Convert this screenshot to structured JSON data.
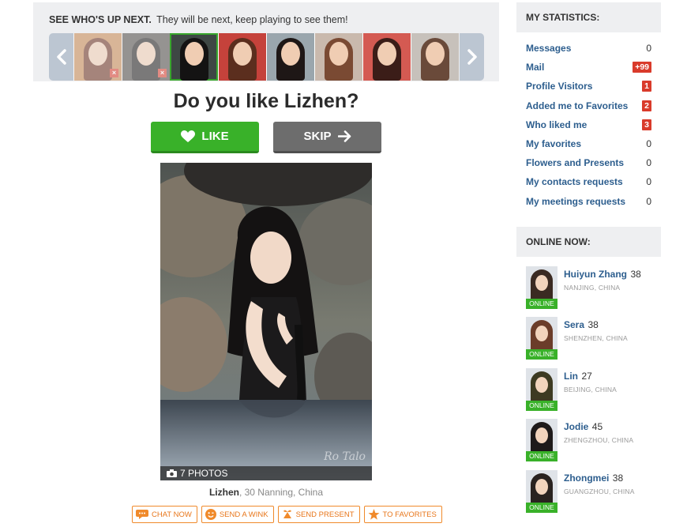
{
  "up_next": {
    "title": "SEE WHO'S UP NEXT.",
    "subtitle": "They will be next, keep playing to see them!",
    "thumbnails": [
      {
        "state": "skipped",
        "bg": "#c7874f"
      },
      {
        "state": "skipped",
        "bg": "#4d4844"
      },
      {
        "state": "current",
        "bg": "#3e4744"
      },
      {
        "state": "upcoming",
        "bg": "#c5423b"
      },
      {
        "state": "upcoming",
        "bg": "#9aa6ad"
      },
      {
        "state": "upcoming",
        "bg": "#c9b9ad"
      },
      {
        "state": "upcoming",
        "bg": "#d45a52"
      },
      {
        "state": "upcoming",
        "bg": "#c7c1bb"
      }
    ],
    "prev_icon": "chevron-left-icon",
    "next_icon": "chevron-right-icon"
  },
  "question": "Do you like Lizhen?",
  "buttons": {
    "like": "LIKE",
    "skip": "SKIP"
  },
  "photo": {
    "count_label": "7 PHOTOS",
    "watermark": "Ro     Talo"
  },
  "profile": {
    "name": "Lizhen",
    "age": ", 30",
    "location": " Nanning, China"
  },
  "actions": [
    {
      "label": "CHAT NOW",
      "icon": "chat-icon"
    },
    {
      "label": "SEND A WINK",
      "icon": "wink-icon"
    },
    {
      "label": "SEND PRESENT",
      "icon": "gift-icon"
    },
    {
      "label": "TO FAVORITES",
      "icon": "star-icon"
    }
  ],
  "statistics": {
    "title": "MY STATISTICS:",
    "rows": [
      {
        "label": "Messages",
        "value": "0",
        "badge": false
      },
      {
        "label": "Mail",
        "value": "+99",
        "badge": true
      },
      {
        "label": "Profile Visitors",
        "value": "1",
        "badge": true
      },
      {
        "label": "Added me to Favorites",
        "value": "2",
        "badge": true
      },
      {
        "label": "Who liked me",
        "value": "3",
        "badge": true
      },
      {
        "label": "My favorites",
        "value": "0",
        "badge": false
      },
      {
        "label": "Flowers and Presents",
        "value": "0",
        "badge": false
      },
      {
        "label": "My contacts requests",
        "value": "0",
        "badge": false
      },
      {
        "label": "My meetings requests",
        "value": "0",
        "badge": false
      }
    ]
  },
  "online_now": {
    "title": "ONLINE NOW:",
    "tag": "ONLINE",
    "members": [
      {
        "name": "Huiyun Zhang",
        "age": "38",
        "location": "NANJING, CHINA",
        "hair": "#3a2a22"
      },
      {
        "name": "Sera",
        "age": "38",
        "location": "SHENZHEN, CHINA",
        "hair": "#6b3d2a"
      },
      {
        "name": "Lin",
        "age": "27",
        "location": "BEIJING, CHINA",
        "hair": "#3d3a22"
      },
      {
        "name": "Jodie",
        "age": "45",
        "location": "ZHENGZHOU, CHINA",
        "hair": "#1e1a1a"
      },
      {
        "name": "Zhongmei",
        "age": "38",
        "location": "GUANGZHOU, CHINA",
        "hair": "#2a2320"
      }
    ]
  },
  "colors": {
    "accent_green": "#39b129",
    "link_blue": "#2d5e8e",
    "badge_red": "#d93b2b",
    "action_orange": "#e8761a"
  }
}
